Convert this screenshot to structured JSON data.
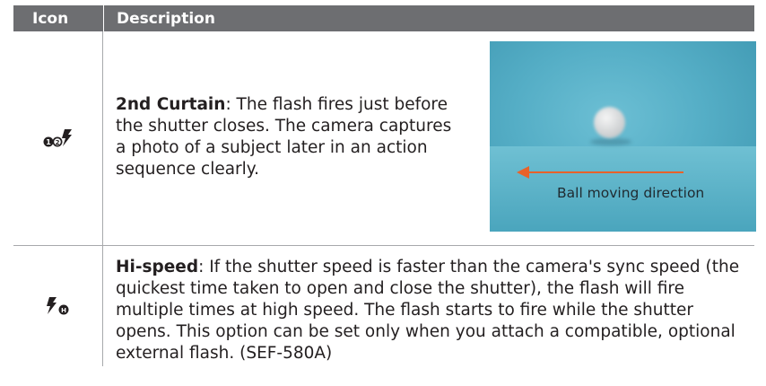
{
  "header": {
    "icon_label": "Icon",
    "description_label": "Description"
  },
  "rows": [
    {
      "icon": "second-curtain-flash-icon",
      "title": "2nd Curtain",
      "text": ": The flash fires just before the shutter closes. The camera captures a photo of a subject later in an action sequence clearly.",
      "image_caption": "Ball moving direction"
    },
    {
      "icon": "hi-speed-flash-icon",
      "title": "Hi-speed",
      "text": ": If the shutter speed is faster than the camera's sync speed (the quickest time taken to open and close the shutter), the flash will fire multiple times at high speed. The flash starts to fire while the shutter opens. This option can be set only when you attach a compatible, optional external flash. (SEF-580A)"
    }
  ],
  "colors": {
    "header_bg": "#6d6e71",
    "arrow": "#e8622a",
    "photo_bg": "#55aec6"
  }
}
